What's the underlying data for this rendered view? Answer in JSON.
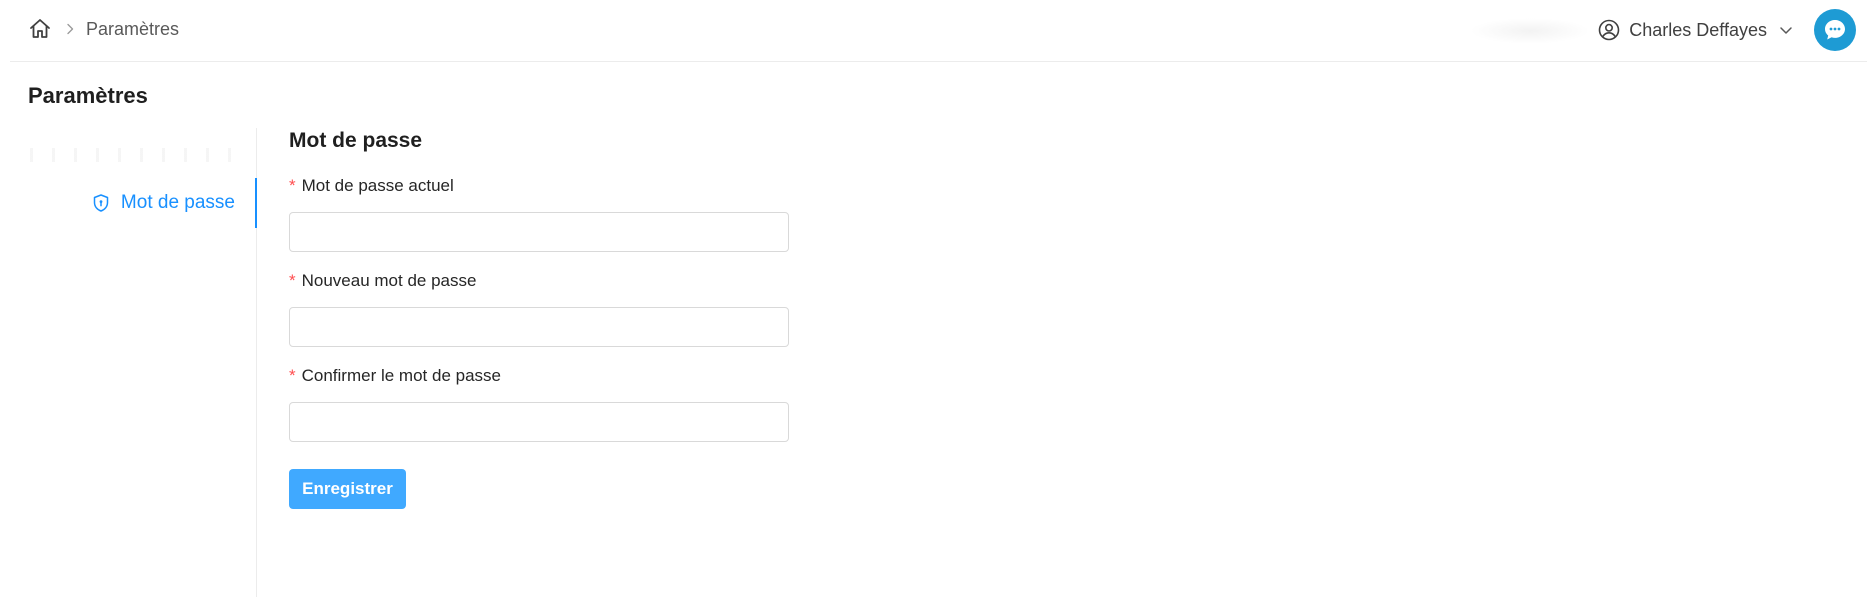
{
  "header": {
    "breadcrumb_current": "Paramètres",
    "user_name": "Charles Deffayes"
  },
  "page": {
    "title": "Paramètres"
  },
  "sidebar": {
    "items": [
      {
        "label": "Mot de passe",
        "icon": "shield-icon",
        "active": true
      }
    ]
  },
  "form": {
    "title": "Mot de passe",
    "required_mark": "*",
    "fields": [
      {
        "label": "Mot de passe actuel",
        "value": "",
        "placeholder": ""
      },
      {
        "label": "Nouveau mot de passe",
        "value": "",
        "placeholder": ""
      },
      {
        "label": "Confirmer le mot de passe",
        "value": "",
        "placeholder": ""
      }
    ],
    "submit_label": "Enregistrer"
  },
  "colors": {
    "accent": "#1890ff",
    "button": "#40a9ff",
    "chat_fab": "#1e9bd4",
    "required": "#ff4d4f"
  }
}
